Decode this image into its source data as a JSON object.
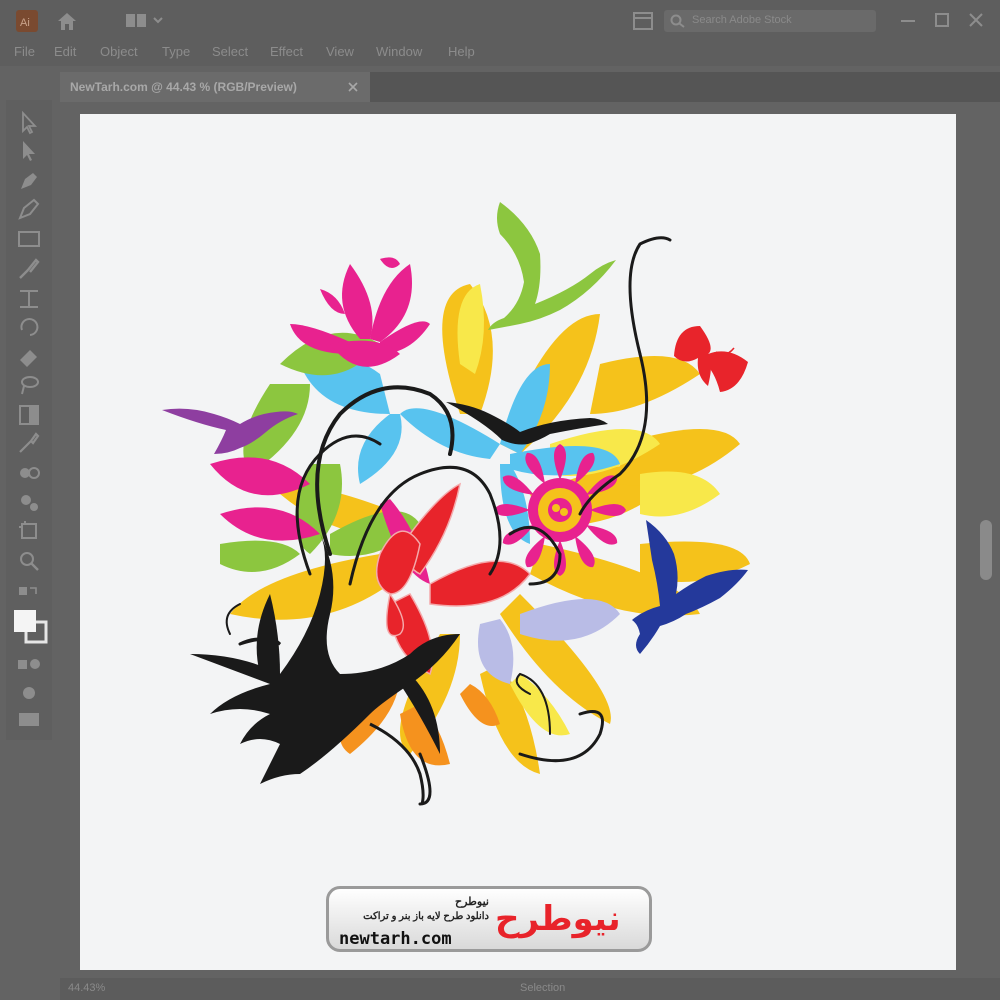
{
  "app": {
    "icon_label": "Ai"
  },
  "menu": [
    "File",
    "Edit",
    "Object",
    "Type",
    "Select",
    "Effect",
    "View",
    "Window",
    "Help"
  ],
  "search": {
    "placeholder": "Search Adobe Stock"
  },
  "document": {
    "tab_title": "NewTarh.com @ 44.43 % (RGB/Preview)"
  },
  "status": {
    "zoom": "44.43%",
    "mode": "Selection"
  },
  "logo": {
    "line1": "نیوطرح",
    "line2": "دانلود طرح لایه باز بنر و تراکت",
    "url": "newtarh.com",
    "mark": "نیوطرح"
  },
  "icons": {
    "home": "home-icon",
    "workspace": "workspace-icon",
    "search": "search-icon",
    "minimize": "minimize-icon",
    "restore": "restore-icon",
    "close": "close-icon"
  },
  "colors": {
    "magenta": "#e8228f",
    "yellow": "#f5c21b",
    "sky": "#58c3ef",
    "green": "#8cc63f",
    "purple": "#8e3ea0",
    "red": "#e8242b",
    "blue": "#24399b",
    "orange": "#f5921e",
    "black": "#1a1a1a"
  }
}
